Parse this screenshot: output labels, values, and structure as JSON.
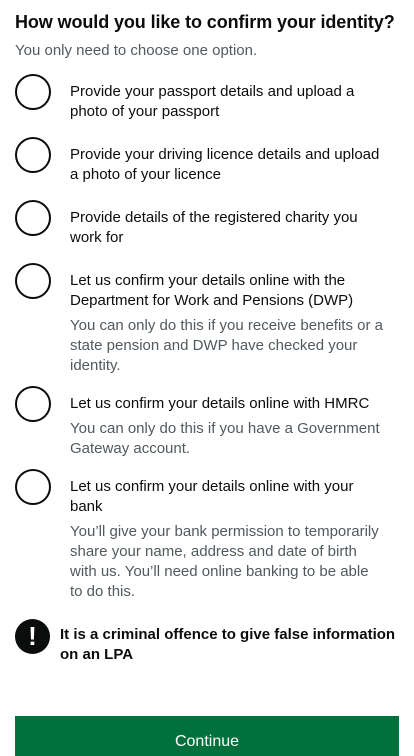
{
  "question": {
    "heading": "How would you like to confirm your identity?",
    "hint": "You only need to choose one option."
  },
  "options": [
    {
      "label": "Provide your passport details and upload a photo of your passport",
      "hint": ""
    },
    {
      "label": "Provide your driving licence details and upload a photo of your licence",
      "hint": ""
    },
    {
      "label": "Provide details of the registered charity you work for",
      "hint": ""
    },
    {
      "label": "Let us confirm your details online with the Department for Work and Pensions (DWP)",
      "hint": "You can only do this if you receive benefits or a state pension and DWP have checked your identity."
    },
    {
      "label": "Let us confirm your details online with HMRC",
      "hint": "You can only do this if you have a Government Gateway account."
    },
    {
      "label": "Let us confirm your details online with your bank",
      "hint": "You’ll give your bank permission to temporarily share your name, address and date of birth with us. You’ll need online banking to be able to do this."
    }
  ],
  "warning": {
    "icon_symbol": "!",
    "icon": "exclamation-icon",
    "text": "It is a criminal offence to give false information on an LPA"
  },
  "actions": {
    "continue_label": "Continue"
  },
  "colors": {
    "text": "#0b0c0c",
    "secondary_text": "#505a5f",
    "button_green": "#00703c",
    "button_shadow": "#002d18"
  }
}
